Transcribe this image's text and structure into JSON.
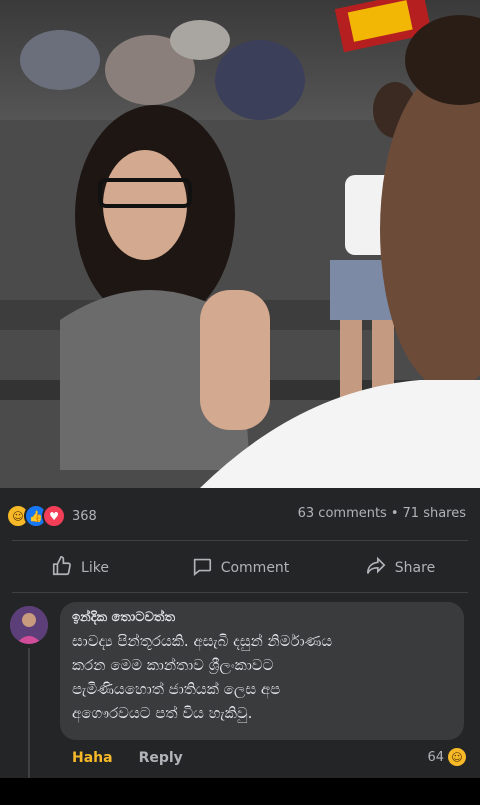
{
  "post": {
    "reaction_icons": [
      "haha-icon",
      "like-icon",
      "love-icon"
    ],
    "reaction_count": "368",
    "comments_count": "63 comments",
    "separator": "•",
    "shares_count": "71 shares"
  },
  "actions": {
    "like": "Like",
    "comment": "Comment",
    "share": "Share"
  },
  "comment": {
    "author": "ඉන්දික තොටවත්ත",
    "text": "සාවද්‍ය පින්තූරයකි. අසැබි දසුන් නිර්මාණය\nකරන මෙම කාන්තාව ශ්‍රීලංකාවට\nපැමිණියහොත් ජාතියක් ලෙස අප\nඅගෞරවයට පත් විය හැකිවු.",
    "haha_label": "Haha",
    "reply_label": "Reply",
    "reaction_count": "64"
  },
  "colors": {
    "background": "#18191a",
    "card": "#242526",
    "bubble": "#3a3b3c",
    "haha_accent": "#f7b928",
    "like_blue": "#1877f2",
    "love_red": "#f33e58"
  }
}
